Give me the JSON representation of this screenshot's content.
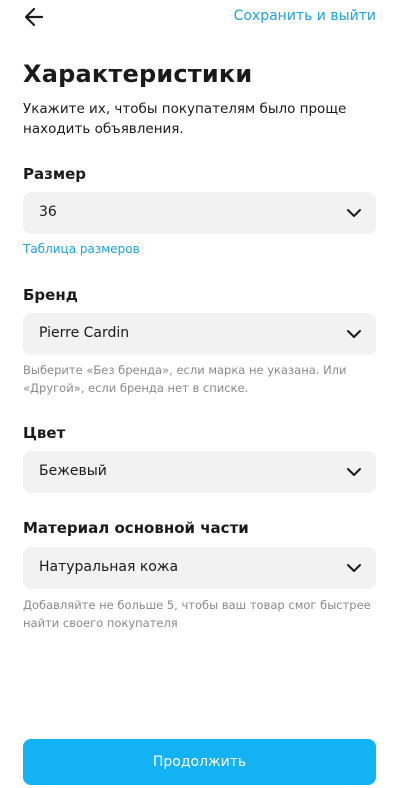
{
  "header": {
    "back_icon": "arrow-left-icon",
    "save_label": "Сохранить и выйти"
  },
  "page": {
    "title": "Характеристики",
    "subtitle": "Укажите их, чтобы покупателям было проще находить объявления."
  },
  "fields": {
    "size": {
      "label": "Размер",
      "value": "36",
      "link": "Таблица размеров"
    },
    "brand": {
      "label": "Бренд",
      "value": "Pierre Cardin",
      "hint": "Выберите «Без бренда», если марка не указана. Или «Другой», если бренда нет в списке."
    },
    "color": {
      "label": "Цвет",
      "value": "Бежевый"
    },
    "material": {
      "label": "Материал основной части",
      "value": "Натуральная кожа",
      "hint": "Добавляйте не больше 5, чтобы ваш товар смог быстрее найти своего покупателя"
    }
  },
  "footer": {
    "continue_label": "Продолжить"
  },
  "colors": {
    "accent": "#1aa3e6",
    "button": "#12b2f5",
    "field_bg": "#f2f2f2",
    "hint_text": "#8a8a8a"
  }
}
